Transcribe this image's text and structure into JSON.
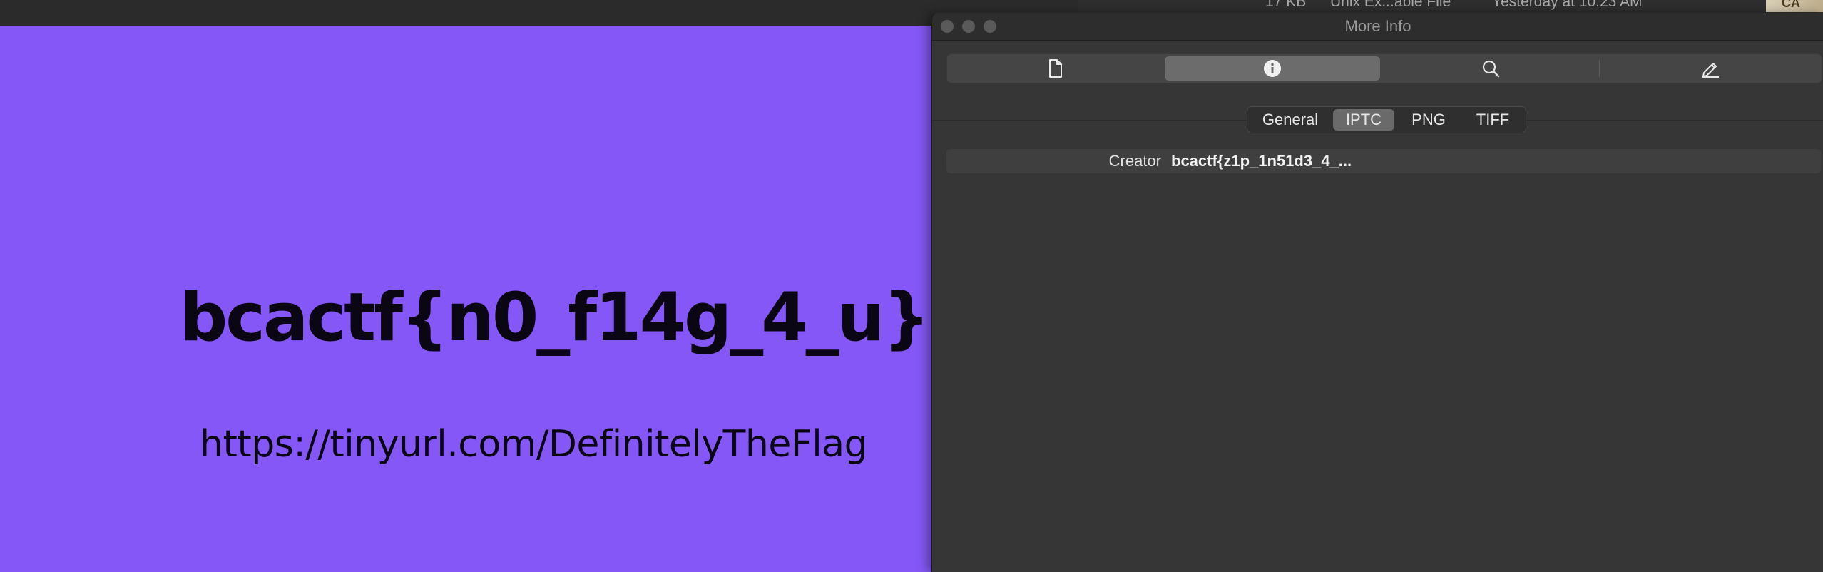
{
  "background": {
    "row_text": [
      "17 KB",
      "Unix Ex...able File",
      "Yesterday at 10:23 AM"
    ],
    "thumb_text": "CA"
  },
  "preview": {
    "flag": "bcactf{n0_f14g_4_u}",
    "url": "https://tinyurl.com/DefinitelyTheFlag",
    "background_color": "#8457f6"
  },
  "info_window": {
    "title": "More Info",
    "toolbar": [
      "document-icon",
      "info-icon",
      "search-icon",
      "edit-icon"
    ],
    "active_toolbar_index": 1,
    "tabs": [
      "General",
      "IPTC",
      "PNG",
      "TIFF"
    ],
    "active_tab": "IPTC",
    "metadata": [
      {
        "key": "Creator",
        "value": "bcactf{z1p_1n51d3_4_..."
      }
    ]
  }
}
